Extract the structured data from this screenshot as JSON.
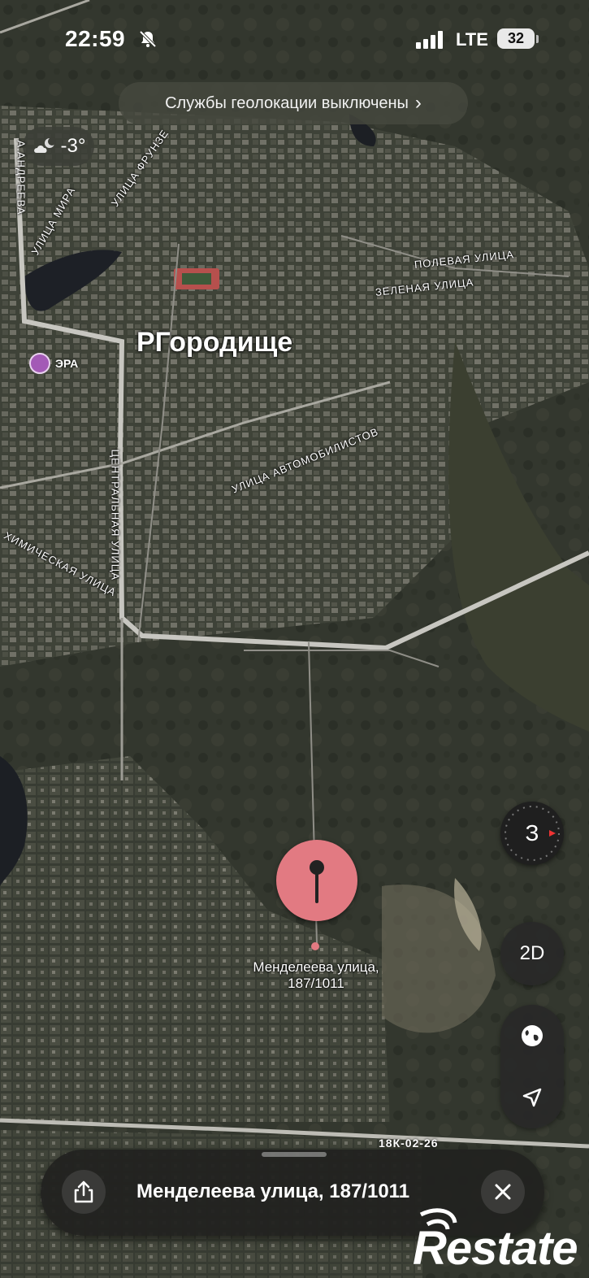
{
  "status_bar": {
    "time": "22:59",
    "network": "LTE",
    "battery": "32",
    "icons": [
      "bell-slash-icon",
      "signal-icon",
      "battery-icon"
    ]
  },
  "banner": {
    "text": "Службы геолокации выключены",
    "chevron": "›"
  },
  "weather": {
    "temp": "-3°",
    "icon": "cloud-moon-icon"
  },
  "map": {
    "city": "РГородище",
    "poi": {
      "name": "ЭРА",
      "icon": "guitar-icon",
      "color": "#a35ab6"
    },
    "streets": {
      "andreeva": "А.АНДРЕЕВА",
      "mira": "УЛИЦА МИРА",
      "frunze": "УЛИЦА ФРУНЗЕ",
      "polevaya": "ПОЛЕВАЯ УЛИЦА",
      "zelenaya": "ЗЕЛЕНАЯ УЛИЦА",
      "avtomobilistov": "УЛИЦА АВТОМОБИЛИСТОВ",
      "centralnaya": "ЦЕНТРАЛЬНАЯ УЛИЦА",
      "khimicheskaya": "ХИМИЧЕСКАЯ УЛИЦА"
    },
    "road_tag": "18К-02-26",
    "pin": {
      "label": "Менделеева улица, 187/1011",
      "color": "#e27a82"
    }
  },
  "controls": {
    "compass": "З",
    "mode": "2D",
    "globe_icon": "globe-icon",
    "locate_icon": "location-arrow-icon"
  },
  "sheet": {
    "title": "Менделеева улица, 187/1011",
    "share_icon": "share-icon",
    "close_icon": "close-icon"
  },
  "watermark": {
    "text": "Restate"
  }
}
